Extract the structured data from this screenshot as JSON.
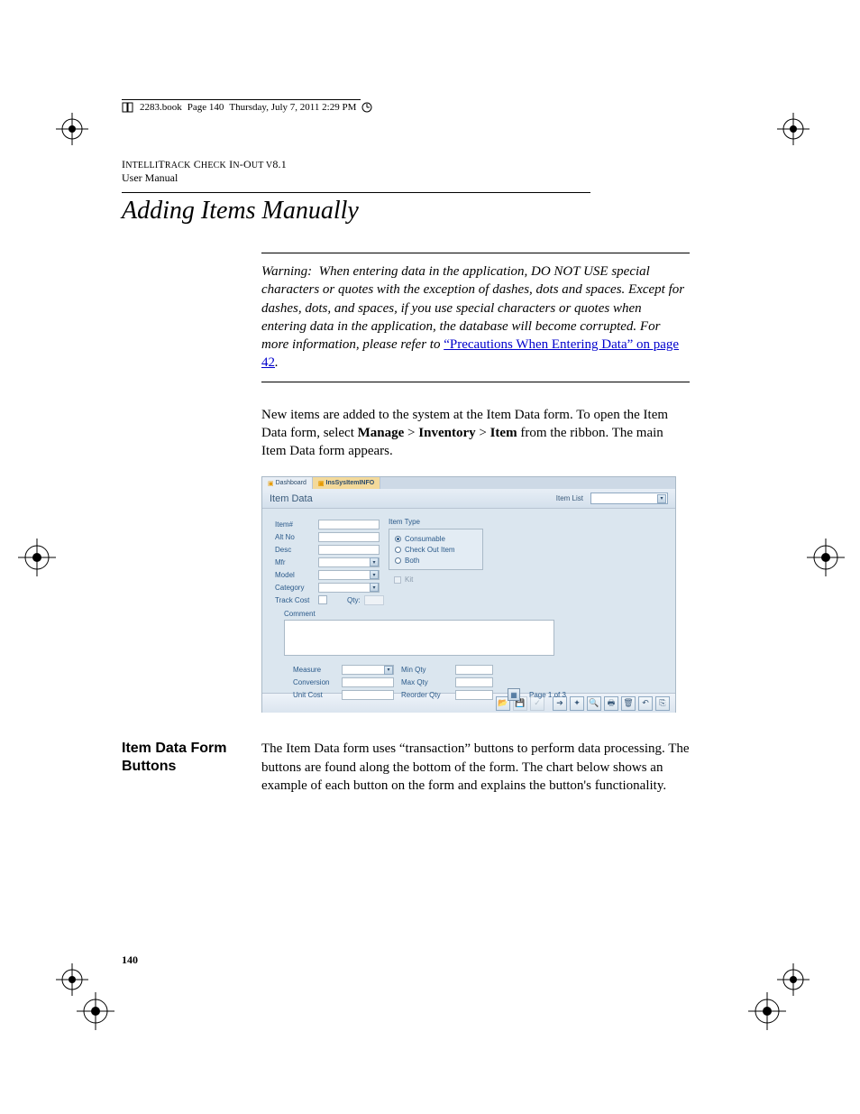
{
  "meta": {
    "book": "2283.book",
    "page_label": "Page 140",
    "timestamp": "Thursday, July 7, 2011  2:29 PM"
  },
  "header": {
    "product": "IntelliTrack Check In-Out v8.1",
    "doc": "User Manual"
  },
  "title": "Adding Items Manually",
  "warning": {
    "prefix": "Warning:",
    "body": "When entering data in the application, DO NOT USE special characters or quotes with the exception of dashes, dots and spaces. Except for dashes, dots, and spaces, if you use special characters or quotes when entering data in the application, the database will become corrupted. For more information, please refer to ",
    "link": "“Precautions When Entering Data” on page 42",
    "after": "."
  },
  "intro": {
    "p1a": "New items are added to the system at the Item Data form. To open the Item Data form, select ",
    "b1": "Manage",
    "sep1": " > ",
    "b2": "Inventory",
    "sep2": " > ",
    "b3": "Item",
    "p1b": " from the ribbon. The main Item Data form appears."
  },
  "screenshot": {
    "tabs": {
      "dashboard": "Dashboard",
      "active": "InsSysItemINFO"
    },
    "form_title": "Item Data",
    "item_list": "Item List",
    "labels": {
      "item_no": "Item#",
      "alt_no": "Alt No",
      "desc": "Desc",
      "mfr": "Mfr",
      "model": "Model",
      "category": "Category",
      "track_cost": "Track Cost",
      "qty": "Qty:",
      "item_type": "Item Type",
      "consumable": "Consumable",
      "check_out": "Check Out Item",
      "both": "Both",
      "kit": "Kit",
      "comment": "Comment",
      "measure": "Measure",
      "conversion": "Conversion",
      "unit_cost": "Unit Cost",
      "min_qty": "Min Qty",
      "max_qty": "Max Qty",
      "reorder_qty": "Reorder Qty"
    },
    "pager": "Page 1 of 3"
  },
  "section2": {
    "heading": "Item Data Form Buttons",
    "body": "The Item Data form uses “transaction” buttons to perform data processing. The buttons are found along the bottom of the form. The chart below shows an example of each button on the form and explains the button's functionality."
  },
  "page_number": "140"
}
